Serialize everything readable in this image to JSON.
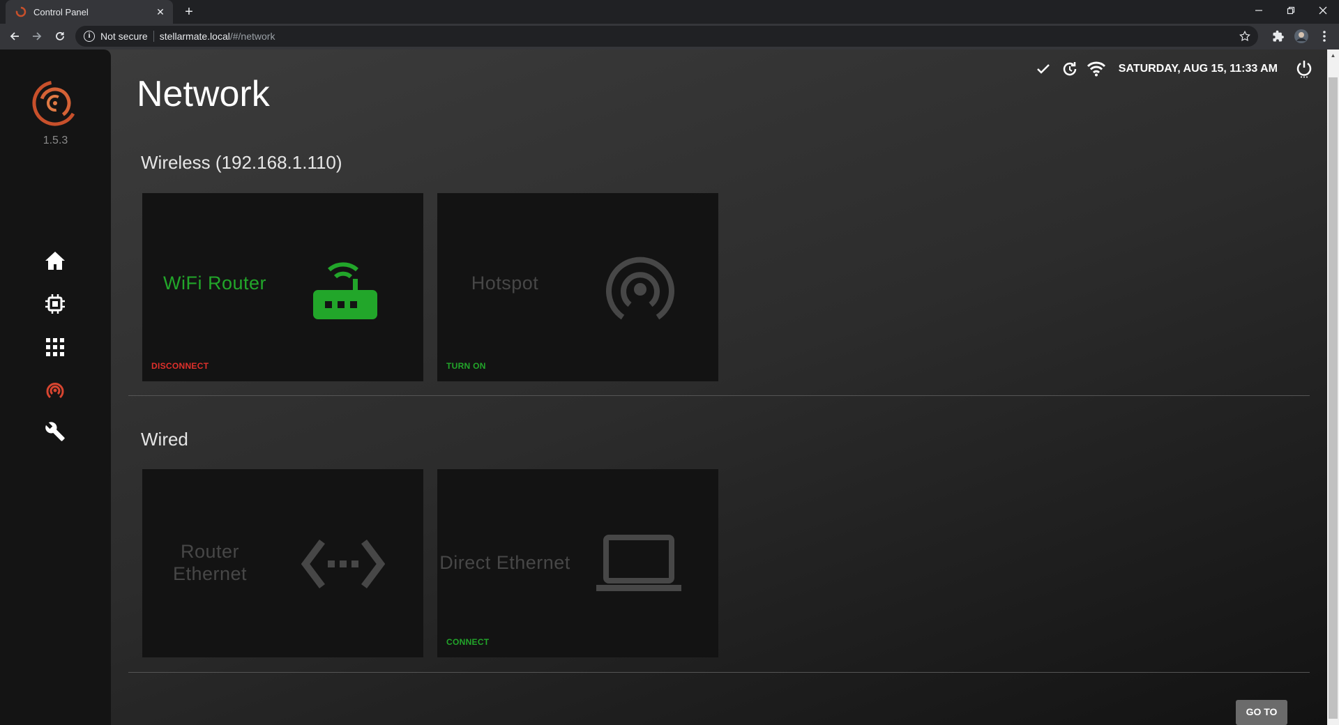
{
  "browser": {
    "tab_title": "Control Panel",
    "tab_close": "✕",
    "new_tab": "+",
    "not_secure": "Not secure",
    "url_host": "stellarmate.local",
    "url_path": "/#/network"
  },
  "app": {
    "version": "1.5.3",
    "page_title": "Network",
    "datetime": "SATURDAY, AUG 15, 11:33 AM",
    "nav": [
      "home-icon",
      "chip-icon",
      "apps-grid-icon",
      "network-icon",
      "wrench-icon"
    ],
    "accent_colors": {
      "active": "#22a62a",
      "danger": "#e0302b",
      "nav_active": "#d84530",
      "muted": "#474747"
    }
  },
  "sections": {
    "wireless": {
      "title": "Wireless (192.168.1.110)",
      "cards": [
        {
          "label": "WiFi Router",
          "icon": "router-icon",
          "action": "DISCONNECT"
        },
        {
          "label": "Hotspot",
          "icon": "hotspot-icon",
          "action": "TURN ON"
        }
      ]
    },
    "wired": {
      "title": "Wired",
      "cards": [
        {
          "label": "Router Ethernet",
          "icon": "ethernet-icon",
          "action": ""
        },
        {
          "label": "Direct Ethernet",
          "icon": "laptop-icon",
          "action": "CONNECT"
        }
      ]
    }
  },
  "goto_button": "GO TO"
}
